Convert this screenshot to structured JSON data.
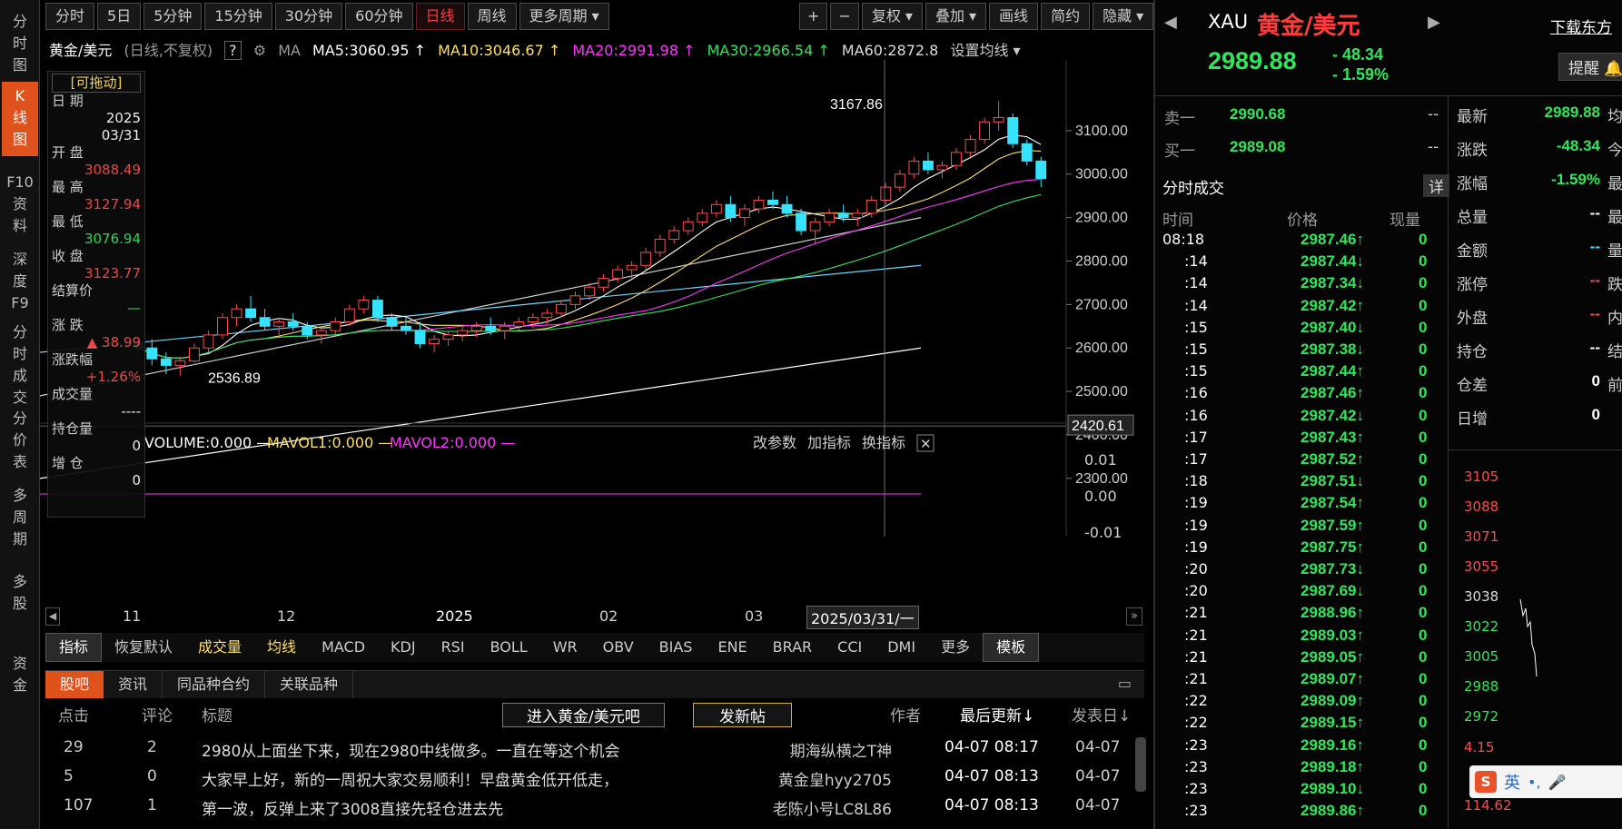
{
  "sidebar": [
    {
      "label": "分时图",
      "active": false
    },
    {
      "label": "K线图",
      "active": true
    },
    {
      "label": "F10资料",
      "active": false
    },
    {
      "label": "深度F9",
      "active": false
    },
    {
      "label": "分时成交",
      "active": false
    },
    {
      "label": "分价表",
      "active": false
    },
    {
      "label": "多周期",
      "active": false
    },
    {
      "label": "多股",
      "active": false
    },
    {
      "label": "资金",
      "active": false
    }
  ],
  "toolbar": {
    "periods": [
      "分时",
      "5日",
      "5分钟",
      "15分钟",
      "30分钟",
      "60分钟",
      "日线",
      "周线",
      "更多周期 ▾"
    ],
    "active_period": "日线",
    "tools": [
      "+",
      "−",
      "复权 ▾",
      "叠加 ▾",
      "画线",
      "简约",
      "隐藏 ▾",
      "⤢"
    ]
  },
  "legend": {
    "symbol": "黄金/美元",
    "mode": "(日线,不复权)",
    "help": "?",
    "ma_label": "MA",
    "ma5": "MA5:3060.95 ↑",
    "ma10": "MA10:3046.67 ↑",
    "ma20": "MA20:2991.98 ↑",
    "ma30": "MA30:2966.54 ↑",
    "ma60": "MA60:2872.8",
    "settings": "设置均线 ▾"
  },
  "tooltip": {
    "drag": "[可拖动]",
    "date_label": "日 期",
    "date_year": "2025",
    "date_md": "03/31",
    "open_label": "开 盘",
    "open": "3088.49",
    "high_label": "最 高",
    "high": "3127.94",
    "low_label": "最 低",
    "low": "3076.94",
    "close_label": "收 盘",
    "close": "3123.77",
    "settle_label": "结算价",
    "settle": "—",
    "chg_label": "涨 跌",
    "chg": "▲ 38.99",
    "pct_label": "涨跌幅",
    "pct": "+1.26%",
    "vol_label": "成交量",
    "vol": "----",
    "oi_label": "持仓量",
    "oi": "0",
    "inc_label": "增 仓",
    "inc": "0"
  },
  "chart_data": {
    "type": "candlestick",
    "price_axis": [
      "3100.00",
      "3000.00",
      "2900.00",
      "2800.00",
      "2700.00",
      "2600.00",
      "2500.00",
      "2400.00",
      "2300.00"
    ],
    "price_range": [
      2260,
      3200
    ],
    "cursor_price": "2420.61",
    "high_label": "3167.86",
    "low_label": "2536.89",
    "x_labels": [
      "11",
      "12",
      "2025",
      "02",
      "03"
    ],
    "cursor_date": "2025/03/31/一",
    "volume_legend": "VOLUME:0.000 —",
    "mavol1": "MAVOL1:0.000 —",
    "mavol2": "MAVOL2:0.000 —",
    "vol_axis": [
      "0.01",
      "0.00",
      "-0.01"
    ],
    "vol_links": [
      "改参数",
      "加指标",
      "换指标"
    ],
    "ohlc": [
      [
        2610,
        2630,
        2580,
        2600
      ],
      [
        2600,
        2620,
        2560,
        2575
      ],
      [
        2575,
        2590,
        2540,
        2560
      ],
      [
        2560,
        2580,
        2537,
        2570
      ],
      [
        2570,
        2610,
        2565,
        2600
      ],
      [
        2600,
        2640,
        2590,
        2630
      ],
      [
        2630,
        2680,
        2620,
        2670
      ],
      [
        2670,
        2700,
        2650,
        2690
      ],
      [
        2690,
        2720,
        2660,
        2670
      ],
      [
        2670,
        2690,
        2640,
        2650
      ],
      [
        2650,
        2670,
        2630,
        2660
      ],
      [
        2660,
        2680,
        2640,
        2650
      ],
      [
        2650,
        2660,
        2620,
        2630
      ],
      [
        2630,
        2650,
        2610,
        2640
      ],
      [
        2640,
        2670,
        2630,
        2660
      ],
      [
        2660,
        2700,
        2650,
        2690
      ],
      [
        2690,
        2720,
        2680,
        2710
      ],
      [
        2710,
        2720,
        2660,
        2670
      ],
      [
        2670,
        2680,
        2640,
        2650
      ],
      [
        2650,
        2670,
        2630,
        2640
      ],
      [
        2640,
        2660,
        2600,
        2610
      ],
      [
        2610,
        2630,
        2590,
        2620
      ],
      [
        2620,
        2640,
        2605,
        2630
      ],
      [
        2630,
        2650,
        2615,
        2640
      ],
      [
        2640,
        2660,
        2625,
        2650
      ],
      [
        2650,
        2670,
        2630,
        2640
      ],
      [
        2640,
        2660,
        2620,
        2650
      ],
      [
        2650,
        2670,
        2640,
        2660
      ],
      [
        2660,
        2680,
        2645,
        2670
      ],
      [
        2670,
        2690,
        2655,
        2680
      ],
      [
        2680,
        2710,
        2670,
        2700
      ],
      [
        2700,
        2730,
        2690,
        2720
      ],
      [
        2720,
        2750,
        2710,
        2740
      ],
      [
        2740,
        2770,
        2730,
        2760
      ],
      [
        2760,
        2790,
        2750,
        2780
      ],
      [
        2780,
        2800,
        2760,
        2790
      ],
      [
        2790,
        2830,
        2780,
        2820
      ],
      [
        2820,
        2860,
        2810,
        2850
      ],
      [
        2850,
        2880,
        2840,
        2870
      ],
      [
        2870,
        2900,
        2860,
        2890
      ],
      [
        2890,
        2920,
        2880,
        2910
      ],
      [
        2910,
        2940,
        2900,
        2930
      ],
      [
        2930,
        2950,
        2890,
        2900
      ],
      [
        2900,
        2930,
        2880,
        2920
      ],
      [
        2920,
        2950,
        2910,
        2940
      ],
      [
        2940,
        2960,
        2920,
        2930
      ],
      [
        2930,
        2950,
        2900,
        2910
      ],
      [
        2910,
        2920,
        2860,
        2870
      ],
      [
        2870,
        2900,
        2840,
        2890
      ],
      [
        2890,
        2920,
        2880,
        2910
      ],
      [
        2910,
        2930,
        2890,
        2900
      ],
      [
        2900,
        2920,
        2880,
        2910
      ],
      [
        2910,
        2950,
        2900,
        2940
      ],
      [
        2940,
        2980,
        2930,
        2970
      ],
      [
        2970,
        3010,
        2960,
        3000
      ],
      [
        3000,
        3040,
        2990,
        3030
      ],
      [
        3030,
        3050,
        3000,
        3010
      ],
      [
        3010,
        3030,
        2990,
        3020
      ],
      [
        3020,
        3060,
        3010,
        3050
      ],
      [
        3050,
        3090,
        3040,
        3080
      ],
      [
        3080,
        3130,
        3070,
        3120
      ],
      [
        3120,
        3168,
        3100,
        3130
      ],
      [
        3130,
        3140,
        3060,
        3070
      ],
      [
        3070,
        3080,
        3020,
        3030
      ],
      [
        3030,
        3040,
        2970,
        2990
      ]
    ]
  },
  "indicator_tabs": [
    "指标",
    "恢复默认",
    "成交量",
    "均线",
    "MACD",
    "KDJ",
    "RSI",
    "BOLL",
    "WR",
    "OBV",
    "BIAS",
    "ENE",
    "BRAR",
    "CCI",
    "DMI",
    "更多",
    "模板"
  ],
  "bbs": {
    "tabs": [
      "股吧",
      "资讯",
      "同品种合约",
      "关联品种"
    ],
    "headers": [
      "点击",
      "评论",
      "标题"
    ],
    "enter_button": "进入黄金/美元吧",
    "post_button": "发新帖",
    "author_header": "作者",
    "last_update_header": "最后更新↓",
    "post_date_header": "发表日↓",
    "posts": [
      {
        "clicks": "29",
        "comments": "2",
        "title": "2980从上面坐下来，现在2980中线做多。一直在等这个机会",
        "author": "期海纵横之T神",
        "updated": "04-07 08:17",
        "posted": "04-07"
      },
      {
        "clicks": "5",
        "comments": "0",
        "title": "大家早上好，新的一周祝大家交易顺利！早盘黄金低开低走，",
        "author": "黄金皇hyy2705",
        "updated": "04-07 08:13",
        "posted": "04-07"
      },
      {
        "clicks": "107",
        "comments": "1",
        "title": "第一波，反弹上来了3008直接先轻仓进去先",
        "author": "老陈小号LC8L86",
        "updated": "04-07 08:13",
        "posted": "04-07"
      }
    ]
  },
  "quote": {
    "code": "XAU",
    "name": "黄金/美元",
    "price": "2989.88",
    "change": "- 48.34",
    "pct": "- 1.59%",
    "download": "下载东方",
    "remind": "提醒",
    "ask_label": "卖一",
    "ask": "2990.68",
    "ask_vol": "--",
    "bid_label": "买一",
    "bid": "2989.08",
    "bid_vol": "--"
  },
  "stats": [
    {
      "label": "最新",
      "value": "2989.88",
      "cls": "grn",
      "tail": "均"
    },
    {
      "label": "涨跌",
      "value": "-48.34",
      "cls": "grn",
      "tail": "今"
    },
    {
      "label": "涨幅",
      "value": "-1.59%",
      "cls": "grn",
      "tail": "最"
    },
    {
      "label": "总量",
      "value": "--",
      "cls": "wht",
      "tail": "最"
    },
    {
      "label": "金额",
      "value": "--",
      "cls": "cya",
      "tail": "量"
    },
    {
      "label": "涨停",
      "value": "--",
      "cls": "red",
      "tail": "跌"
    },
    {
      "label": "外盘",
      "value": "--",
      "cls": "red",
      "tail": "内"
    },
    {
      "label": "持仓",
      "value": "--",
      "cls": "wht",
      "tail": "结"
    },
    {
      "label": "仓差",
      "value": "0",
      "cls": "wht",
      "tail": "前"
    },
    {
      "label": "日增",
      "value": "0",
      "cls": "wht",
      "tail": ""
    }
  ],
  "trades": {
    "title": "分时成交",
    "detail": "详",
    "headers": [
      "时间",
      "价格",
      "现量"
    ],
    "rows": [
      [
        "08:18",
        "2987.46",
        "up"
      ],
      [
        ":14",
        "2987.44",
        "dn"
      ],
      [
        ":14",
        "2987.34",
        "dn"
      ],
      [
        ":14",
        "2987.42",
        "up"
      ],
      [
        ":15",
        "2987.40",
        "dn"
      ],
      [
        ":15",
        "2987.38",
        "dn"
      ],
      [
        ":15",
        "2987.44",
        "up"
      ],
      [
        ":16",
        "2987.46",
        "up"
      ],
      [
        ":16",
        "2987.42",
        "dn"
      ],
      [
        ":17",
        "2987.43",
        "up"
      ],
      [
        ":17",
        "2987.52",
        "up"
      ],
      [
        ":18",
        "2987.51",
        "dn"
      ],
      [
        ":19",
        "2987.54",
        "up"
      ],
      [
        ":19",
        "2987.59",
        "up"
      ],
      [
        ":19",
        "2987.75",
        "up"
      ],
      [
        ":20",
        "2987.73",
        "dn"
      ],
      [
        ":20",
        "2987.69",
        "dn"
      ],
      [
        ":21",
        "2988.96",
        "up"
      ],
      [
        ":21",
        "2989.03",
        "up"
      ],
      [
        ":21",
        "2989.05",
        "up"
      ],
      [
        ":21",
        "2989.07",
        "up"
      ],
      [
        ":22",
        "2989.09",
        "up"
      ],
      [
        ":22",
        "2989.15",
        "up"
      ],
      [
        ":23",
        "2989.16",
        "up"
      ],
      [
        ":23",
        "2989.18",
        "up"
      ],
      [
        ":23",
        "2989.10",
        "dn"
      ],
      [
        ":23",
        "2989.86",
        "up"
      ]
    ],
    "qty": "0"
  },
  "mini": {
    "axis": [
      "3105",
      "3088",
      "3071",
      "3055",
      "3038",
      "3022",
      "3005",
      "2988",
      "2972"
    ],
    "vol_axis": [
      "4.15",
      "114.62"
    ]
  },
  "ime": {
    "logo": "S",
    "lang": "英",
    "punct": "•,"
  }
}
